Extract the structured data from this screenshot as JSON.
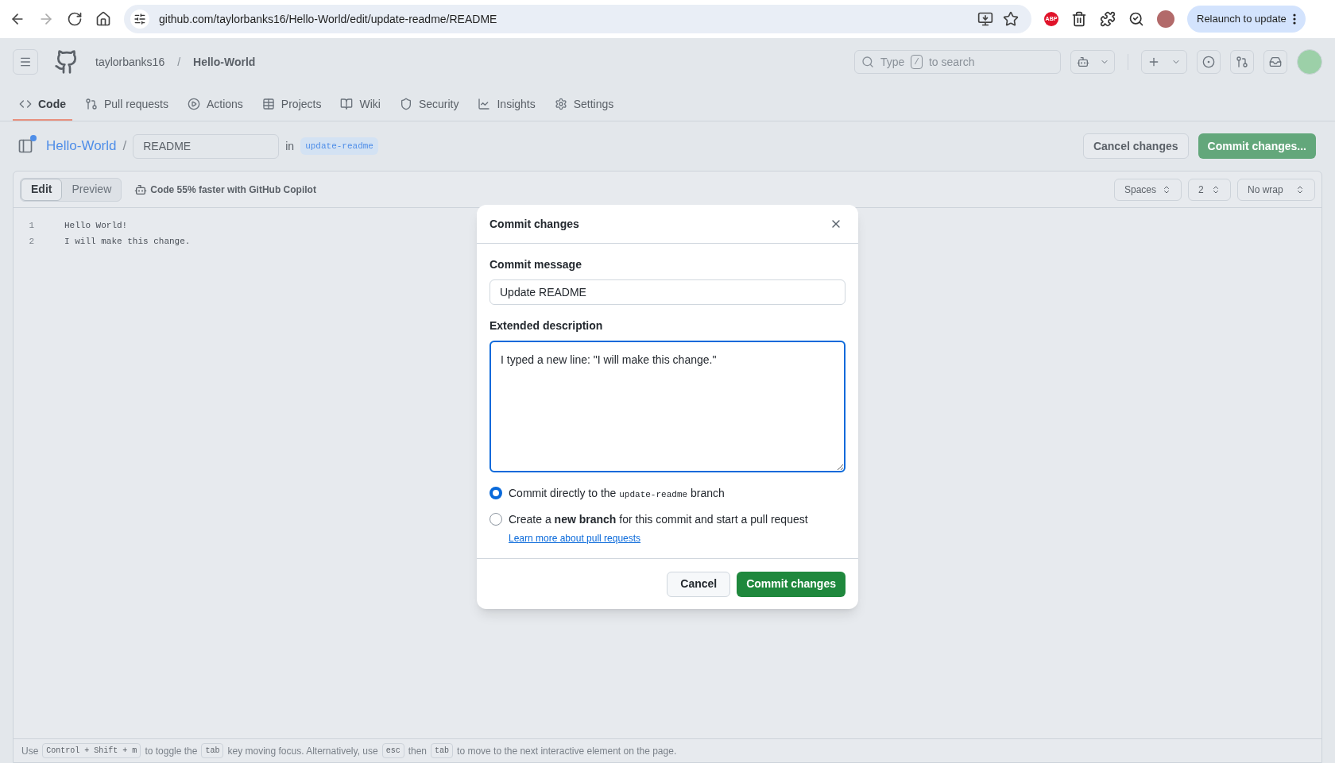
{
  "browser": {
    "url": "github.com/taylorbanks16/Hello-World/edit/update-readme/README",
    "extension_badge": "ABP",
    "relaunch_label": "Relaunch to update"
  },
  "header": {
    "owner": "taylorbanks16",
    "separator": "/",
    "repo": "Hello-World",
    "search": {
      "before": "Type",
      "key": "/",
      "after": "to search"
    }
  },
  "nav_tabs": [
    {
      "label": "Code",
      "selected": true
    },
    {
      "label": "Pull requests",
      "selected": false
    },
    {
      "label": "Actions",
      "selected": false
    },
    {
      "label": "Projects",
      "selected": false
    },
    {
      "label": "Wiki",
      "selected": false
    },
    {
      "label": "Security",
      "selected": false
    },
    {
      "label": "Insights",
      "selected": false
    },
    {
      "label": "Settings",
      "selected": false
    }
  ],
  "breadcrumb": {
    "repo": "Hello-World",
    "separator": "/",
    "filename": "README",
    "in_label": "in",
    "branch": "update-readme"
  },
  "actions": {
    "cancel": "Cancel changes",
    "commit": "Commit changes..."
  },
  "editor": {
    "tabs": [
      {
        "label": "Edit",
        "selected": true
      },
      {
        "label": "Preview",
        "selected": false
      }
    ],
    "copilot": "Code 55% faster with GitHub Copilot",
    "indent_mode": "Spaces",
    "indent_size": "2",
    "wrap": "No wrap",
    "lines": [
      {
        "number": "1",
        "text": "Hello World!"
      },
      {
        "number": "2",
        "text": "I will make this change."
      }
    ]
  },
  "dialog": {
    "title": "Commit changes",
    "message_label": "Commit message",
    "message_value": "Update README",
    "description_label": "Extended description",
    "description_value": "I typed a new line: \"I will make this change.\"",
    "options": [
      {
        "kind": "direct",
        "before": "Commit directly to the",
        "code": "update-readme",
        "after": "branch",
        "selected": true
      },
      {
        "kind": "new_branch",
        "text": "Create a **new branch** for this commit and start a pull request",
        "link": "Learn more about pull requests",
        "selected": false
      }
    ],
    "cancel": "Cancel",
    "submit": "Commit changes"
  },
  "footer_hint": [
    {
      "kind": "text",
      "text": "Use"
    },
    {
      "kind": "key",
      "text": "Control + Shift + m"
    },
    {
      "kind": "text",
      "text": "to toggle the"
    },
    {
      "kind": "key",
      "text": "tab"
    },
    {
      "kind": "text",
      "text": "key moving focus. Alternatively, use"
    },
    {
      "kind": "key",
      "text": "esc"
    },
    {
      "kind": "text",
      "text": "then"
    },
    {
      "kind": "key",
      "text": "tab"
    },
    {
      "kind": "text",
      "text": "to move to the next interactive element on the page."
    }
  ]
}
